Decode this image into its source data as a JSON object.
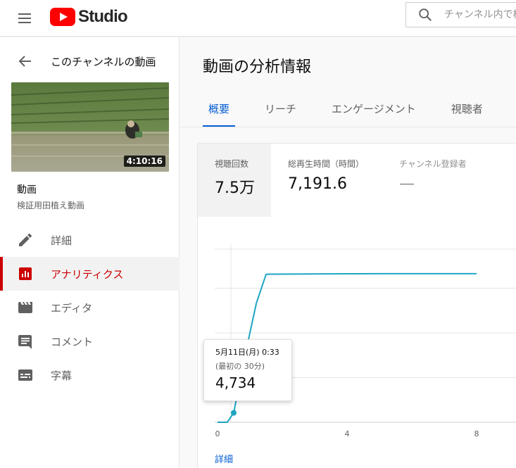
{
  "header": {
    "logo_text": "Studio",
    "search_placeholder": "チャンネル内で検索"
  },
  "sidebar": {
    "back_label": "このチャンネルの動画",
    "video": {
      "duration": "4:10:16",
      "title": "動画",
      "subtitle": "検証用田植え動画"
    },
    "items": [
      {
        "label": "詳細",
        "icon": "pencil-icon",
        "active": false
      },
      {
        "label": "アナリティクス",
        "icon": "analytics-icon",
        "active": true
      },
      {
        "label": "エディタ",
        "icon": "clapperboard-icon",
        "active": false
      },
      {
        "label": "コメント",
        "icon": "comment-icon",
        "active": false
      },
      {
        "label": "字幕",
        "icon": "subtitles-icon",
        "active": false
      }
    ]
  },
  "main": {
    "title": "動画の分析情報",
    "tabs": [
      {
        "label": "概要",
        "active": true
      },
      {
        "label": "リーチ",
        "active": false
      },
      {
        "label": "エンゲージメント",
        "active": false
      },
      {
        "label": "視聴者",
        "active": false
      }
    ],
    "metrics": [
      {
        "label": "視聴回数",
        "value": "7.5万"
      },
      {
        "label": "総再生時間（時間）",
        "value": "7,191.6"
      },
      {
        "label": "チャンネル登録者",
        "value": "—"
      }
    ],
    "tooltip": {
      "date": "5月11日(月) 0:33",
      "sub": "(最初の 30分)",
      "value": "4,734"
    },
    "details_link": "詳細"
  },
  "colors": {
    "accent": "#065fd4",
    "brand_red": "#ff0000",
    "active_red": "#cc0000",
    "line": "#1ea5c3"
  },
  "chart_data": {
    "type": "line",
    "x_ticks": [
      "0",
      "4",
      "8"
    ],
    "x": [
      0,
      0.3,
      0.5,
      0.8,
      1.2,
      1.5,
      2,
      3,
      4,
      5,
      6,
      7,
      8
    ],
    "y": [
      0,
      0.3,
      4734,
      30000,
      60000,
      74500,
      74600,
      74700,
      74750,
      74800,
      74800,
      74800,
      74800
    ],
    "ylim": [
      0,
      90000
    ],
    "grid": true,
    "highlight_index": 2
  }
}
